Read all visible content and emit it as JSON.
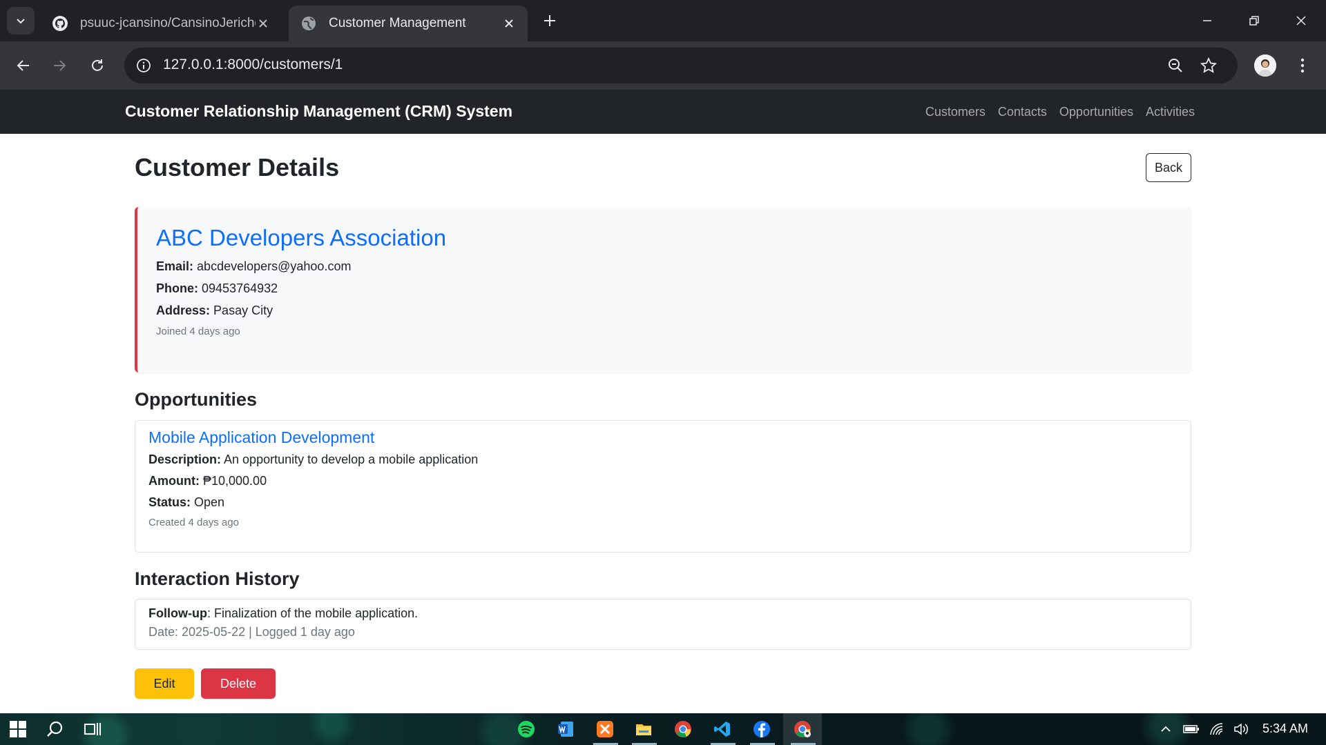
{
  "browser": {
    "tabs": [
      {
        "title": "psuuc-jcansino/CansinoJericho",
        "active": false
      },
      {
        "title": "Customer Management",
        "active": true
      }
    ],
    "url": "127.0.0.1:8000/customers/1"
  },
  "navbar": {
    "brand": "Customer Relationship Management (CRM) System",
    "links": [
      "Customers",
      "Contacts",
      "Opportunities",
      "Activities"
    ]
  },
  "page": {
    "title": "Customer Details",
    "back_label": "Back"
  },
  "customer": {
    "name": "ABC Developers Association",
    "email_label": "Email:",
    "email": "abcdevelopers@yahoo.com",
    "phone_label": "Phone:",
    "phone": "09453764932",
    "address_label": "Address:",
    "address": "Pasay City",
    "joined": "Joined 4 days ago"
  },
  "opportunities": {
    "heading": "Opportunities",
    "items": [
      {
        "title": "Mobile Application Development",
        "description_label": "Description:",
        "description": "An opportunity to develop a mobile application",
        "amount_label": "Amount:",
        "amount": "₱10,000.00",
        "status_label": "Status:",
        "status": "Open",
        "created": "Created 4 days ago"
      }
    ]
  },
  "interactions": {
    "heading": "Interaction History",
    "items": [
      {
        "type": "Follow-up",
        "note": ": Finalization of the mobile application.",
        "meta": "Date: 2025-05-22 | Logged 1 day ago"
      }
    ]
  },
  "actions": {
    "edit_label": "Edit",
    "delete_label": "Delete"
  },
  "taskbar": {
    "clock": "5:34 AM",
    "apps": [
      "spotify-icon",
      "word-icon",
      "xampp-icon",
      "file-explorer-icon",
      "chrome-icon",
      "vscode-icon",
      "facebook-icon",
      "chrome-profile-icon"
    ]
  },
  "colors": {
    "link_blue": "#0d6efd",
    "danger_red": "#dc3545",
    "warning_yellow": "#ffc107",
    "navbar_dark": "#212529"
  }
}
